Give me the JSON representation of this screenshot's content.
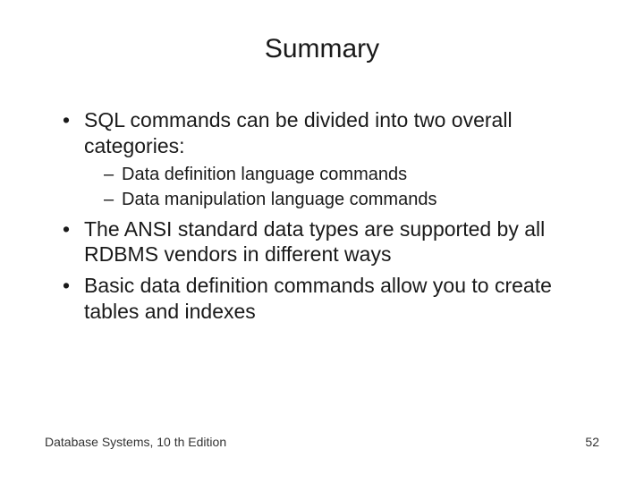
{
  "title": "Summary",
  "bullets": {
    "b1": "SQL commands can be divided into two overall categories:",
    "b1_sub1": "Data definition language commands",
    "b1_sub2": "Data manipulation language commands",
    "b2": "The ANSI standard data types are supported by all RDBMS vendors in different ways",
    "b3": "Basic data definition commands allow you to create tables and indexes"
  },
  "footer": {
    "left": "Database Systems, 10 th Edition",
    "right": "52"
  }
}
